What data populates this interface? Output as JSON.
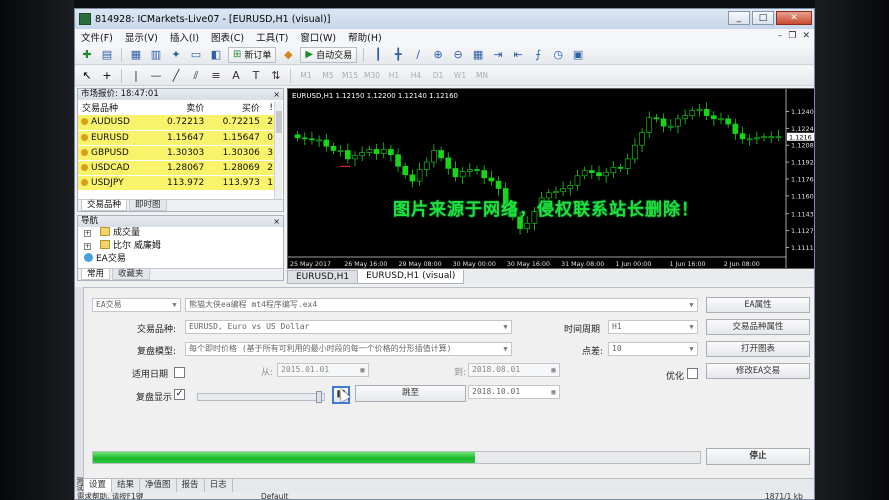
{
  "window": {
    "title": "814928: ICMarkets-Live07 - [EURUSD,H1 (visual)]",
    "controls": [
      "_",
      "□",
      "✕"
    ]
  },
  "menu": [
    "文件(F)",
    "显示(V)",
    "插入(I)",
    "图表(C)",
    "工具(T)",
    "窗口(W)",
    "帮助(H)"
  ],
  "toolbar": {
    "new_order": "新订单",
    "auto_trading": "自动交易",
    "timeframes": [
      "M1",
      "M5",
      "M15",
      "M30",
      "H1",
      "H4",
      "D1",
      "W1",
      "MN"
    ]
  },
  "market_watch": {
    "title": "市场报价: 18:47:01",
    "columns": [
      "交易品种",
      "卖价",
      "买价",
      "!"
    ],
    "rows": [
      {
        "symbol": "AUDUSD",
        "bid": "0.72213",
        "ask": "0.72215",
        "spread": "2"
      },
      {
        "symbol": "EURUSD",
        "bid": "1.15647",
        "ask": "1.15647",
        "spread": "0"
      },
      {
        "symbol": "GBPUSD",
        "bid": "1.30303",
        "ask": "1.30306",
        "spread": "3"
      },
      {
        "symbol": "USDCAD",
        "bid": "1.28067",
        "ask": "1.28069",
        "spread": "2"
      },
      {
        "symbol": "USDJPY",
        "bid": "113.972",
        "ask": "113.973",
        "spread": "1"
      }
    ],
    "tabs": [
      "交易品种",
      "即时图"
    ]
  },
  "navigator": {
    "title": "导航",
    "items": [
      "成交量",
      "比尔 威廉姆",
      "EA交易"
    ],
    "tabs": [
      "常用",
      "收藏夹"
    ]
  },
  "chart": {
    "header": "EURUSD,H1  1.12150 1.12200 1.12140 1.12160",
    "tabs": [
      "EURUSD,H1",
      "EURUSD,H1 (visual)"
    ],
    "active_tab": 1,
    "up_color": "#16d61a",
    "down_color": "#16d61a",
    "background": "#000000"
  },
  "chart_data": {
    "type": "candlestick",
    "title": "EURUSD,H1",
    "y_ticks": [
      "1.1240",
      "1.1224",
      "1.1208",
      "1.1192",
      "1.1176",
      "1.1160",
      "1.1143",
      "1.1127",
      "1.1111"
    ],
    "x_ticks": [
      "25 May 2017",
      "26 May 16:00",
      "29 May 08:00",
      "30 May 00:00",
      "30 May 16:00",
      "31 May 08:00",
      "1 Jun 00:00",
      "1 Jun 16:00",
      "2 Jun 08:00"
    ],
    "current_price_label": "1.1216",
    "close": [
      1.1215,
      1.1214,
      1.1213,
      1.1213,
      1.1207,
      1.1203,
      1.1203,
      1.1195,
      1.1198,
      1.1201,
      1.1204,
      1.12,
      1.1204,
      1.1199,
      1.1188,
      1.118,
      1.1174,
      1.1185,
      1.1192,
      1.1203,
      1.1196,
      1.1186,
      1.1178,
      1.1183,
      1.1185,
      1.1184,
      1.1177,
      1.1174,
      1.1167,
      1.1152,
      1.114,
      1.1129,
      1.1134,
      1.1145,
      1.1158,
      1.1163,
      1.1164,
      1.1167,
      1.117,
      1.1179,
      1.1184,
      1.1182,
      1.1179,
      1.1182,
      1.1187,
      1.1186,
      1.1195,
      1.1208,
      1.122,
      1.1234,
      1.1233,
      1.1226,
      1.1226,
      1.1233,
      1.1236,
      1.1241,
      1.1242,
      1.1236,
      1.1233,
      1.1233,
      1.1228,
      1.1219,
      1.1214,
      1.1214,
      1.1215,
      1.1216,
      1.1216,
      1.1216
    ]
  },
  "watermark": "图片来源于网络，侵权联系站长删除！",
  "tester": {
    "expert_type": "EA交易",
    "expert_file": "熊猫大侠ea编程 mt4程序编写.ex4",
    "symbol_label": "交易品种:",
    "symbol_value": "EURUSD, Euro vs US Dollar",
    "model_label": "复盘模型:",
    "model_value": "每个即时价格 (基于所有可利用的最小时段的每一个价格的分形插值计算)",
    "use_date_label": "适用日期",
    "from_label": "从:",
    "from_value": "2015.01.01",
    "to_label": "到:",
    "to_value": "2018.08.01",
    "visual_label": "复盘显示",
    "skip_to_label": "跳至",
    "skip_to_value": "2018.10.01",
    "period_label": "时间周期",
    "period_value": "H1",
    "spread_label": "点差:",
    "spread_value": "10",
    "optimize_label": "优化",
    "buttons": {
      "expert_properties": "EA属性",
      "symbol_properties": "交易品种属性",
      "open_chart": "打开图表",
      "modify_expert": "修改EA交易",
      "stop": "停止"
    },
    "progress": 0.63,
    "tabs": [
      "设置",
      "结果",
      "净值图",
      "报告",
      "日志"
    ],
    "vertical_label": "测试"
  },
  "statusbar": {
    "help": "需求帮助, 请按F1键",
    "profile": "Default",
    "traffic": "1871/1 kb"
  }
}
